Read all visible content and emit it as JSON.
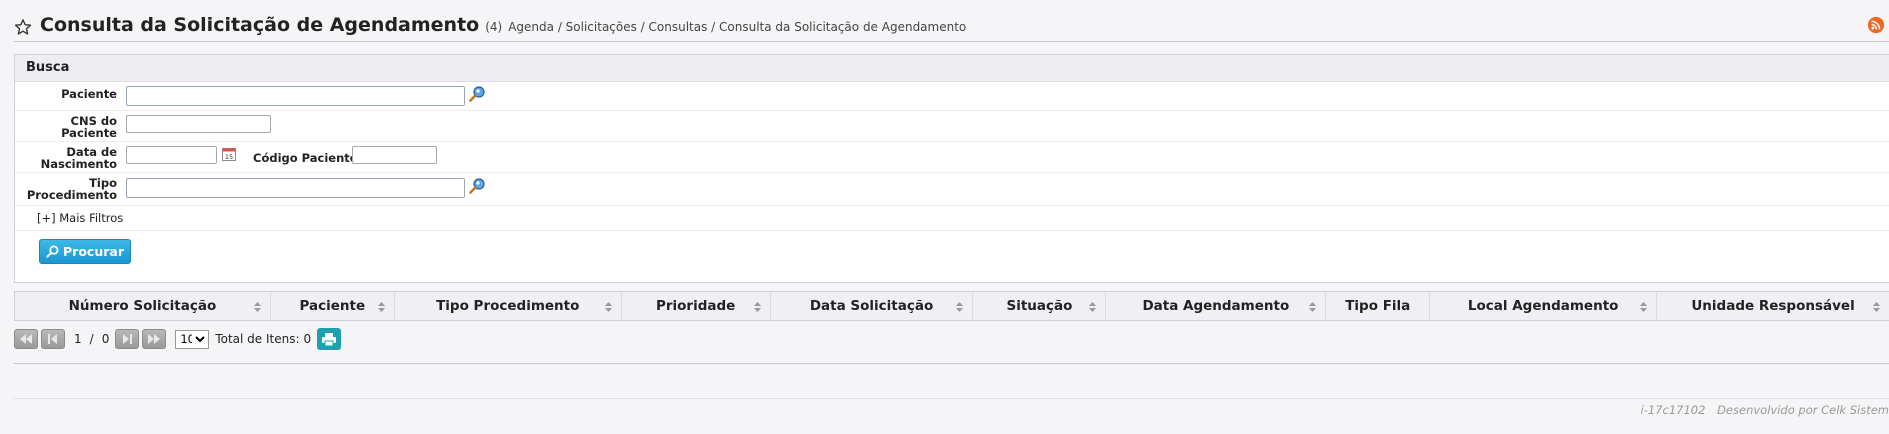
{
  "header": {
    "title": "Consulta da Solicitação de Agendamento",
    "count": "(4)",
    "breadcrumb": "Agenda / Solicitações / Consultas / Consulta da Solicitação de Agendamento"
  },
  "search": {
    "panel_title": "Busca",
    "paciente_label": "Paciente",
    "cns_label_1": "CNS do",
    "cns_label_2": "Paciente",
    "nasc_label_1": "Data de",
    "nasc_label_2": "Nascimento",
    "codigo_label": "Código Paciente",
    "tipo_label_1": "Tipo",
    "tipo_label_2": "Procedimento",
    "paciente_value": "",
    "cns_value": "",
    "nasc_value": "",
    "codigo_value": "",
    "tipo_value": "",
    "more_filters": "[+] Mais Filtros",
    "search_button": "Procurar"
  },
  "table": {
    "columns": [
      "Número Solicitação",
      "Paciente",
      "Tipo Procedimento",
      "Prioridade",
      "Data Solicitação",
      "Situação",
      "Data Agendamento",
      "Tipo Fila",
      "Local Agendamento",
      "Unidade Responsável"
    ]
  },
  "pager": {
    "current_page": "1",
    "separator": "/",
    "total_pages": "0",
    "page_size": "10",
    "total_label": "Total de Itens:",
    "total_value": "0"
  },
  "footer": {
    "version": "i-17c17102",
    "credit": "Desenvolvido por Celk Sistem"
  },
  "colors": {
    "accent": "#1b96cf",
    "rss": "#f26522",
    "print": "#1fa0b0"
  }
}
